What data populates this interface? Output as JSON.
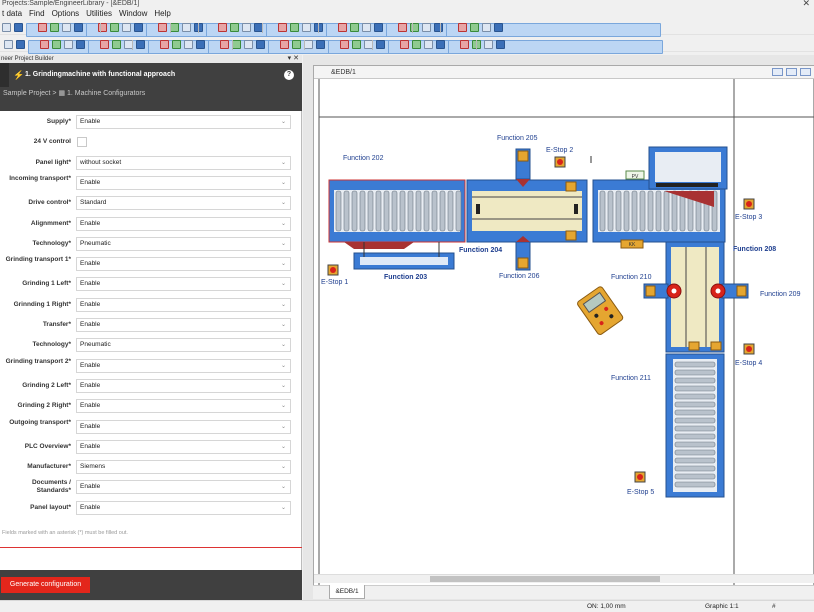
{
  "window": {
    "title": "Projects:Sample/EngineerLibrary - [&EDB/1]",
    "close_glyph": "✕"
  },
  "menu": [
    "t data",
    "Find",
    "Options",
    "Utilities",
    "Window",
    "Help"
  ],
  "panel": {
    "header": "neer Project Builder",
    "header_close": "✕",
    "pin_glyph": "▾",
    "title": "1. Grindingmachine with functional approach",
    "icon_glyph": "⚡",
    "help_glyph": "?",
    "breadcrumb": "Sample Project > ▦ 1. Machine Configurators",
    "fields": [
      {
        "label": "Supply*",
        "type": "select",
        "value": "Enable"
      },
      {
        "label": "24 V control",
        "type": "checkbox",
        "value": ""
      },
      {
        "label": "Panel light*",
        "type": "select",
        "value": "without socket"
      },
      {
        "label": "Incoming transport*",
        "type": "select",
        "value": "Enable"
      },
      {
        "label": "Drive control*",
        "type": "select",
        "value": "Standard"
      },
      {
        "label": "Alignmment*",
        "type": "select",
        "value": "Enable"
      },
      {
        "label": "Technology*",
        "type": "select",
        "value": "Pneumatic"
      },
      {
        "label": "Grinding transport 1*",
        "type": "select",
        "value": "Enable"
      },
      {
        "label": "Grinding 1 Left*",
        "type": "select",
        "value": "Enable"
      },
      {
        "label": "Grinnding 1 Right*",
        "type": "select",
        "value": "Enable"
      },
      {
        "label": "Transfer*",
        "type": "select",
        "value": "Enable"
      },
      {
        "label": "Technology*",
        "type": "select",
        "value": "Pneumatic"
      },
      {
        "label": "Grinding transport 2*",
        "type": "select",
        "value": "Enable"
      },
      {
        "label": "Grinding 2 Left*",
        "type": "select",
        "value": "Enable"
      },
      {
        "label": "Grinding 2 Right*",
        "type": "select",
        "value": "Enable"
      },
      {
        "label": "Outgoing transport*",
        "type": "select",
        "value": "Enable"
      },
      {
        "label": "PLC Overview*",
        "type": "select",
        "value": "Enable"
      },
      {
        "label": "Manufacturer*",
        "type": "select",
        "value": "Siemens"
      },
      {
        "label": "Documents / Standards*",
        "type": "select",
        "value": "Enable"
      },
      {
        "label": "Panel layout*",
        "type": "select",
        "value": "Enable"
      }
    ],
    "note": "Fields marked with an asterisk (*) must be filled out.",
    "generate_button": "Generate configuration",
    "arrow_glyph": "⌄"
  },
  "graphic": {
    "window_title": "&EDB/1",
    "tab_label": "&EDB/1",
    "functions": {
      "f202": "Function 202",
      "f203": "Function 203",
      "f204": "Function 204",
      "f205": "Function 205",
      "f206": "Function 206",
      "f208": "Function 208",
      "f209": "Function 209",
      "f210": "Function 210",
      "f211": "Function 211"
    },
    "estops": {
      "e1": "E-Stop 1",
      "e2": "E-Stop 2",
      "e3": "E-Stop 3",
      "e4": "E-Stop 4",
      "e5": "E-Stop 5"
    },
    "tags": {
      "pv": "PV",
      "kk": "KK"
    },
    "accent_blue": "#3b7bd4",
    "estop_red": "#d8231a"
  },
  "status": {
    "grid": "ON: 1,00 mm",
    "graphic": "Graphic 1:1",
    "hash": "#"
  }
}
